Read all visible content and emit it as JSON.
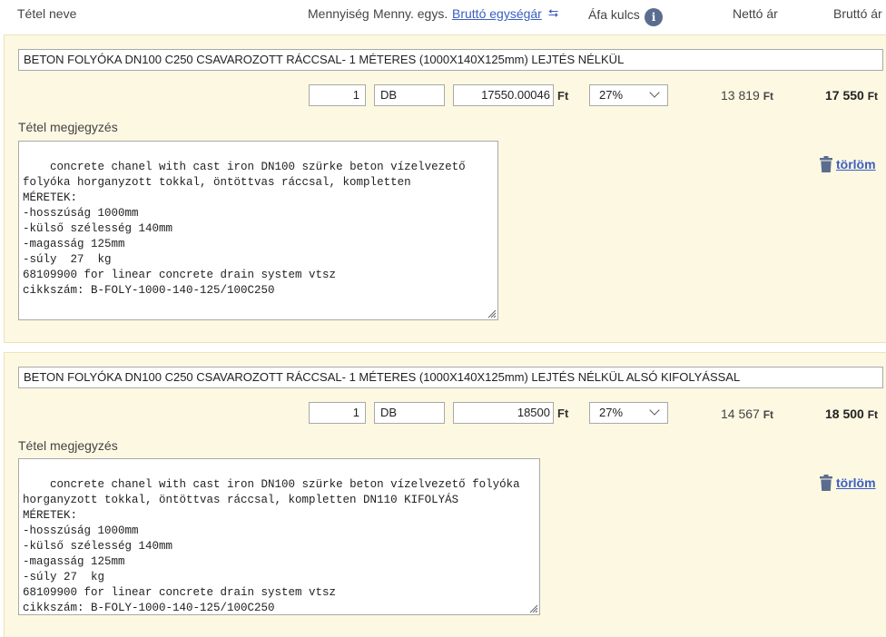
{
  "header": {
    "name": "Tétel neve",
    "quantity": "Mennyiség",
    "unit": "Menny. egys.",
    "gross_unit_price": "Bruttó egységár",
    "swap_glyph": "⮀",
    "vat": "Áfa kulcs",
    "info_glyph": "i",
    "net": "Nettó ár",
    "gross": "Bruttó ár"
  },
  "items": [
    {
      "name": "BETON FOLYÓKA DN100 C250 CSAVAROZOTT RÁCCSAL- 1 MÉTERES (1000X140X125mm) LEJTÉS NÉLKÜL",
      "quantity": "1",
      "unit": "DB",
      "unit_price": "17550.00046",
      "currency": "Ft",
      "vat": "27%",
      "net": "13 819",
      "gross": "17 550",
      "note_label": "Tétel megjegyzés",
      "note": "concrete chanel with cast iron DN100 szürke beton vízelvezető\nfolyóka horganyzott tokkal, öntöttvas ráccsal, kompletten\nMÉRETEK:\n-hosszúság 1000mm\n-külső szélesség 140mm\n-magasság 125mm\n-súly  27  kg\n68109900 for linear concrete drain system vtsz\ncikkszám: B-FOLY-1000-140-125/100C250",
      "delete": "törlöm"
    },
    {
      "name": "BETON FOLYÓKA DN100 C250 CSAVAROZOTT RÁCCSAL- 1 MÉTERES (1000X140X125mm) LEJTÉS NÉLKÜL ALSÓ KIFOLYÁSSAL",
      "quantity": "1",
      "unit": "DB",
      "unit_price": "18500",
      "currency": "Ft",
      "vat": "27%",
      "net": "14 567",
      "gross": "18 500",
      "note_label": "Tétel megjegyzés",
      "note": "concrete chanel with cast iron DN100 szürke beton vízelvezető folyóka\nhorganyzott tokkal, öntöttvas ráccsal, kompletten DN110 KIFOLYÁS\nMÉRETEK:\n-hosszúság 1000mm\n-külső szélesség 140mm\n-magasság 125mm\n-súly 27  kg\n68109900 for linear concrete drain system vtsz\ncikkszám: B-FOLY-1000-140-125/100C250",
      "delete": "törlöm"
    }
  ],
  "colors": {
    "card_background": "#fdf8e2",
    "link": "#3a5ec4",
    "info_icon": "#5a6d8f",
    "trash_icon": "#5a6d8f"
  },
  "icons": {
    "swap": "swap-arrows-icon",
    "info": "info-icon",
    "delete": "trash-icon",
    "dropdown": "chevron-down-icon"
  }
}
